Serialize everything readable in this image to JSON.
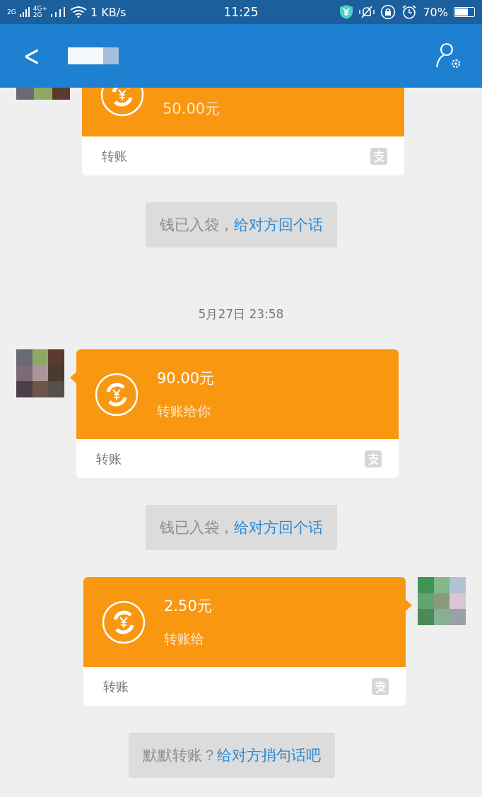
{
  "status_bar": {
    "network_1": "2G",
    "network_2": "4G+",
    "network_3": "2G",
    "speed": "1 KB/s",
    "time": "11:25",
    "battery": "70%"
  },
  "header": {
    "back": "<"
  },
  "messages": [
    {
      "kind": "transfer",
      "outgoing": false,
      "cut_off": true,
      "amount": "50.00元",
      "footer": "转账"
    },
    {
      "kind": "hint",
      "text": "钱已入袋，",
      "link": "给对方回个话"
    },
    {
      "kind": "time",
      "text": "5月27日 23:58"
    },
    {
      "kind": "transfer",
      "outgoing": false,
      "cut_off": false,
      "amount": "90.00元",
      "note": "转账给你",
      "footer": "转账"
    },
    {
      "kind": "hint",
      "text": "钱已入袋，",
      "link": "给对方回个话"
    },
    {
      "kind": "transfer",
      "outgoing": true,
      "cut_off": false,
      "amount": "2.50元",
      "note": "转账给",
      "footer": "转账"
    },
    {
      "kind": "hint",
      "text": "默默转账？",
      "link": "给对方捎句话吧"
    }
  ]
}
